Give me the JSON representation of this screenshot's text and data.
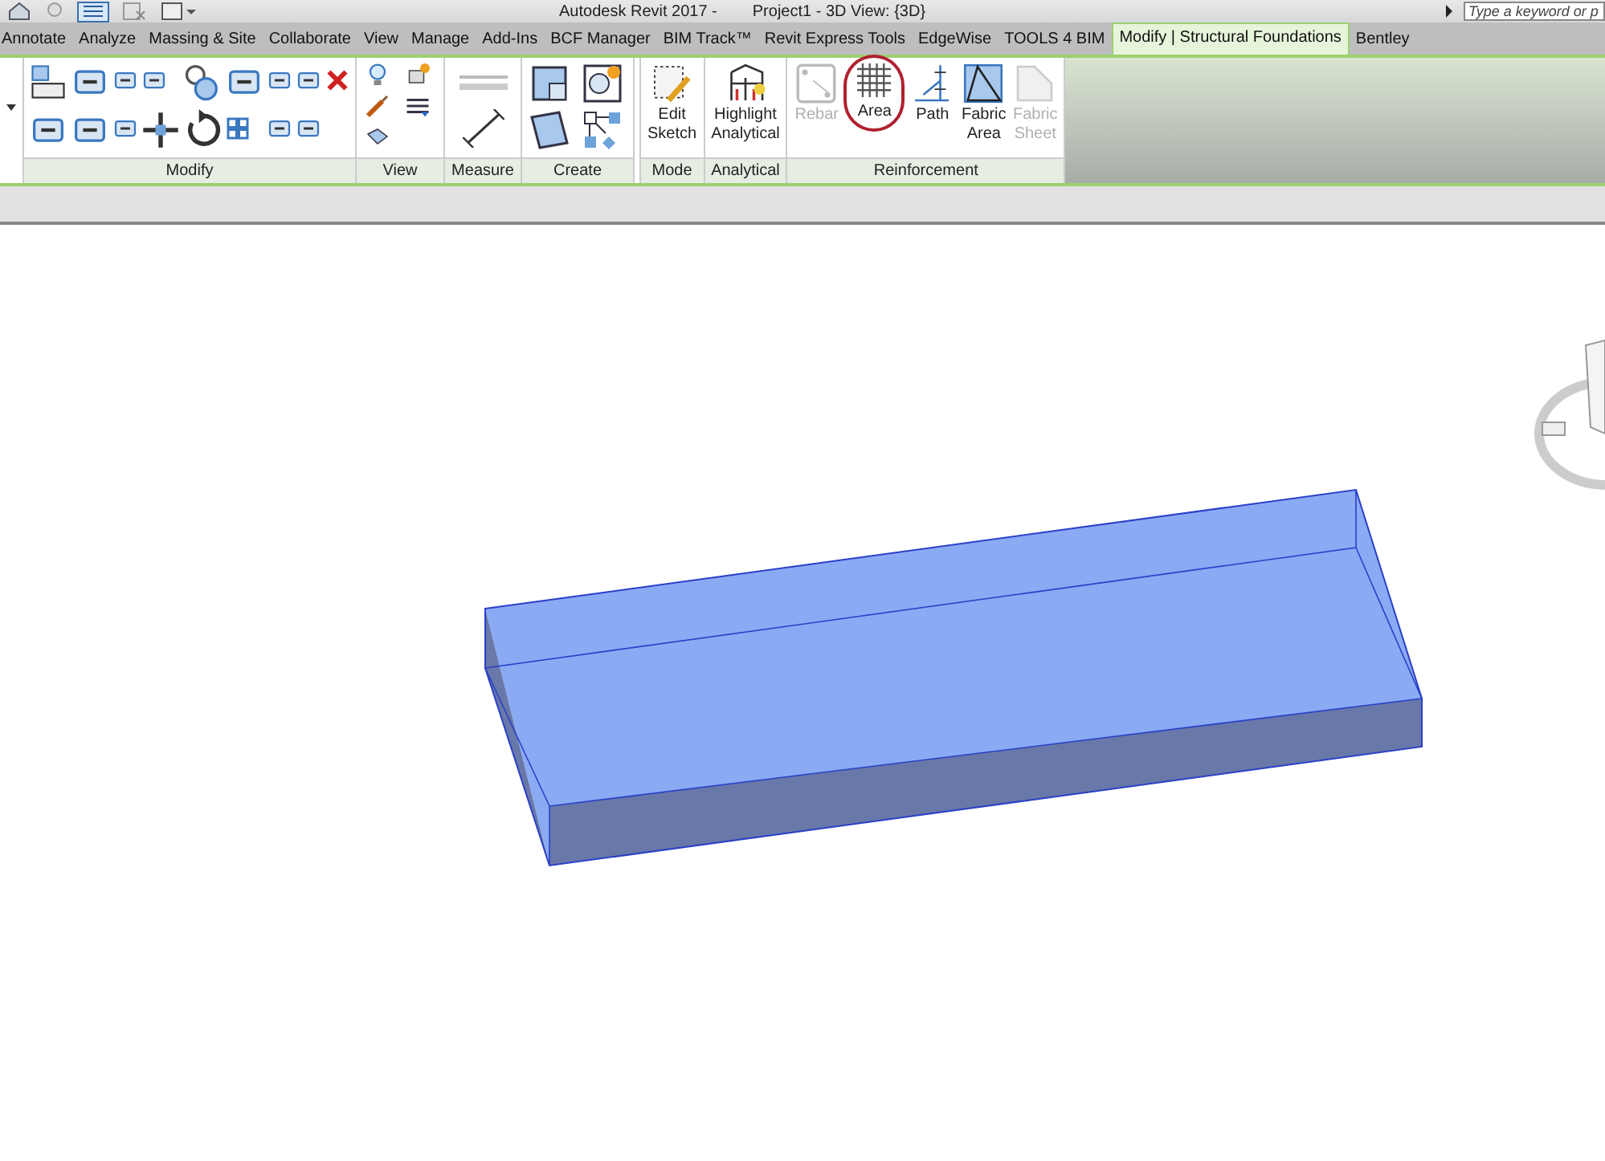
{
  "window": {
    "title": "Autodesk Revit 2017 -",
    "document": "Project1 - 3D View: {3D}"
  },
  "search": {
    "placeholder": "Type a keyword or p"
  },
  "tabs": [
    {
      "label": "Annotate",
      "selected": false
    },
    {
      "label": "Analyze",
      "selected": false
    },
    {
      "label": "Massing & Site",
      "selected": false
    },
    {
      "label": "Collaborate",
      "selected": false
    },
    {
      "label": "View",
      "selected": false
    },
    {
      "label": "Manage",
      "selected": false
    },
    {
      "label": "Add-Ins",
      "selected": false
    },
    {
      "label": "BCF Manager",
      "selected": false
    },
    {
      "label": "BIM Track™",
      "selected": false
    },
    {
      "label": "Revit Express Tools",
      "selected": false
    },
    {
      "label": "EdgeWise",
      "selected": false
    },
    {
      "label": "TOOLS 4 BIM",
      "selected": false
    },
    {
      "label": "Modify | Structural Foundations",
      "selected": true
    },
    {
      "label": "Bentley",
      "selected": false
    }
  ],
  "panels": [
    {
      "label": "Modify",
      "kind": "modify"
    },
    {
      "label": "View",
      "kind": "view"
    },
    {
      "label": "Measure",
      "kind": "measure"
    },
    {
      "label": "Create",
      "kind": "create"
    },
    {
      "label": "Mode",
      "kind": "tools",
      "buttons": [
        {
          "label": "Edit\nSketch",
          "disabled": false,
          "circled": false
        }
      ]
    },
    {
      "label": "Analytical",
      "kind": "tools",
      "buttons": [
        {
          "label": "Highlight\nAnalytical",
          "disabled": false,
          "circled": false
        }
      ]
    },
    {
      "label": "Reinforcement",
      "kind": "tools",
      "buttons": [
        {
          "label": "Rebar",
          "disabled": true,
          "circled": false
        },
        {
          "label": "Area",
          "disabled": false,
          "circled": true
        },
        {
          "label": "Path",
          "disabled": false,
          "circled": false
        },
        {
          "label": "Fabric\nArea",
          "disabled": false,
          "circled": false
        },
        {
          "label": "Fabric\nSheet",
          "disabled": true,
          "circled": false
        }
      ]
    }
  ]
}
